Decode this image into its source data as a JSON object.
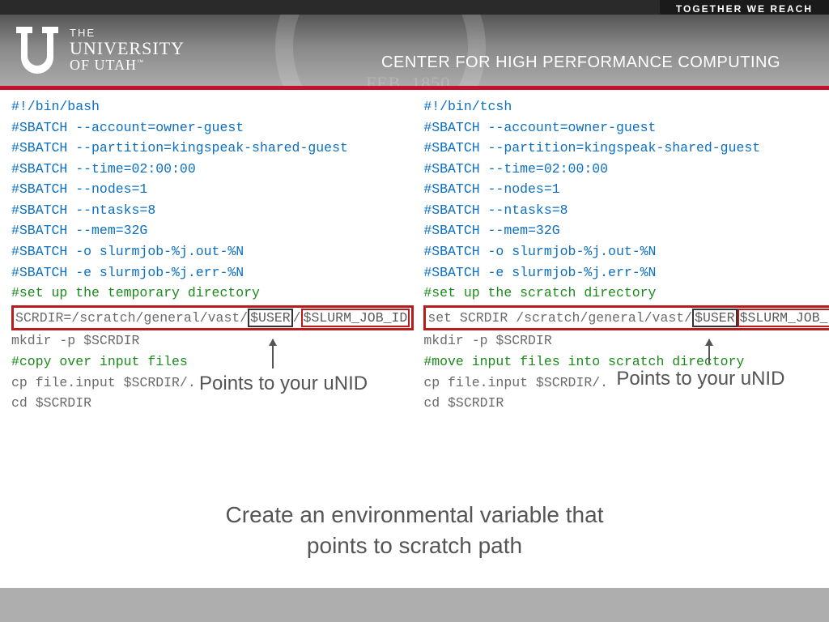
{
  "tagline": "TOGETHER WE REACH",
  "logo": {
    "line1": "THE",
    "line2": "UNIVERSITY",
    "line3": "OF UTAH",
    "tm": "™"
  },
  "center_title": "CENTER FOR HIGH PERFORMANCE COMPUTING",
  "bash": {
    "l1": "#!/bin/bash",
    "l2": "#SBATCH --account=owner-guest",
    "l3": "#SBATCH --partition=kingspeak-shared-guest",
    "l4": "#SBATCH --time=02:00:00",
    "l5": "#SBATCH --nodes=1",
    "l6": "#SBATCH --ntasks=8",
    "l7": "#SBATCH --mem=32G",
    "l8": "#SBATCH -o slurmjob-%j.out-%N",
    "l9": "#SBATCH -e slurmjob-%j.err-%N",
    "l10": "#set up the temporary directory",
    "scr_pre": "SCRDIR=/scratch/general/vast/",
    "scr_user": "$USER",
    "scr_sep": "/",
    "scr_job": "$SLURM_JOB_ID",
    "l12": "mkdir -p $SCRDIR",
    "l13": "#copy over input files",
    "l14": "cp file.input $SCRDIR/.",
    "l15": "cd $SCRDIR"
  },
  "tcsh": {
    "l1": "#!/bin/tcsh",
    "l2": "#SBATCH --account=owner-guest",
    "l3": "#SBATCH --partition=kingspeak-shared-guest",
    "l4": "#SBATCH --time=02:00:00",
    "l5": "#SBATCH --nodes=1",
    "l6": "#SBATCH --ntasks=8",
    "l7": "#SBATCH --mem=32G",
    "l8": "#SBATCH -o slurmjob-%j.out-%N",
    "l9": "#SBATCH -e slurmjob-%j.err-%N",
    "l10": "#set up the scratch directory",
    "scr_pre": "set SCRDIR /scratch/general/vast/",
    "scr_user": "$USER",
    "scr_sep": "/",
    "scr_job": "$SLURM_JOB_ID",
    "l12": "mkdir -p $SCRDIR",
    "l13": "#move input files into scratch directory",
    "l14": "cp file.input $SCRDIR/.",
    "l15": "cd $SCRDIR"
  },
  "annot_left": "Points to your uNID",
  "annot_right": "Points to your uNID",
  "caption_l1": "Create an environmental variable that",
  "caption_l2": "points to scratch path"
}
